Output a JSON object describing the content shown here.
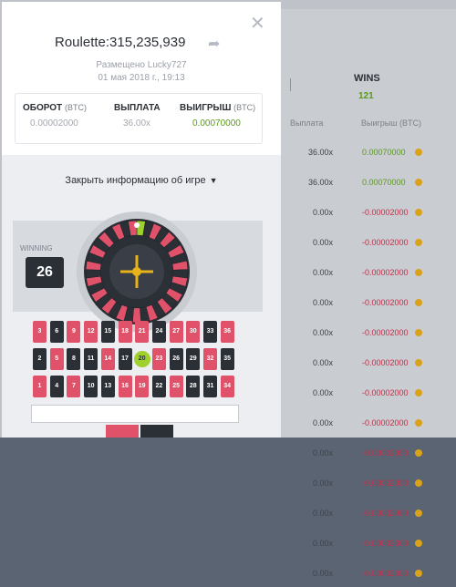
{
  "modal": {
    "title": "Roulette:315,235,939",
    "placed_by": "Размещено Lucky727",
    "date": "01 мая 2018 г., 19:13",
    "stats": [
      {
        "label": "ОБОРОТ",
        "unit": "(BTC)",
        "value": "0.00002000",
        "tone": "muted"
      },
      {
        "label": "ВЫПЛАТА",
        "unit": "",
        "value": "36.00x",
        "tone": "muted"
      },
      {
        "label": "ВЫИГРЫШ",
        "unit": "(BTC)",
        "value": "0.00070000",
        "tone": "green"
      }
    ],
    "toggle_label": "Закрыть информацию об игре",
    "winning_label": "WINNING",
    "winning_number": "26"
  },
  "background": {
    "wins_title": "WINS",
    "wins_value": "121",
    "col_payout": "Выплата",
    "col_win": "Выигрыш (BTC)",
    "rows": [
      {
        "payout": "36.00x",
        "win": "0.00070000",
        "tone": "pos"
      },
      {
        "payout": "36.00x",
        "win": "0.00070000",
        "tone": "pos"
      },
      {
        "payout": "0.00x",
        "win": "-0.00002000",
        "tone": "neg"
      },
      {
        "payout": "0.00x",
        "win": "-0.00002000",
        "tone": "neg"
      },
      {
        "payout": "0.00x",
        "win": "-0.00002000",
        "tone": "neg"
      },
      {
        "payout": "0.00x",
        "win": "-0.00002000",
        "tone": "neg"
      },
      {
        "payout": "0.00x",
        "win": "-0.00002000",
        "tone": "neg"
      },
      {
        "payout": "0.00x",
        "win": "-0.00002000",
        "tone": "neg"
      },
      {
        "payout": "0.00x",
        "win": "-0.00002000",
        "tone": "neg"
      },
      {
        "payout": "0.00x",
        "win": "-0.00002000",
        "tone": "neg"
      },
      {
        "payout": "0.00x",
        "win": "-0.00002000",
        "tone": "neg"
      },
      {
        "payout": "0.00x",
        "win": "-0.00002000",
        "tone": "neg"
      },
      {
        "payout": "0.00x",
        "win": "-0.00002000",
        "tone": "neg"
      },
      {
        "payout": "0.00x",
        "win": "-0.00002000",
        "tone": "neg"
      },
      {
        "payout": "0.00x",
        "win": "-0.00002000",
        "tone": "neg"
      }
    ]
  },
  "table_rows": [
    [
      3,
      6,
      9,
      12,
      15,
      18,
      21,
      24,
      27,
      30,
      33,
      36
    ],
    [
      2,
      5,
      8,
      11,
      14,
      17,
      20,
      23,
      26,
      29,
      32,
      35
    ],
    [
      1,
      4,
      7,
      10,
      13,
      16,
      19,
      22,
      25,
      28,
      31,
      34
    ]
  ],
  "red_numbers": [
    1,
    3,
    5,
    7,
    9,
    12,
    14,
    16,
    18,
    19,
    21,
    23,
    25,
    27,
    30,
    32,
    34,
    36
  ],
  "highlighted_number": 20,
  "colors": {
    "red": "#e0526a",
    "black": "#2b2f36",
    "green": "#9ed12b"
  }
}
